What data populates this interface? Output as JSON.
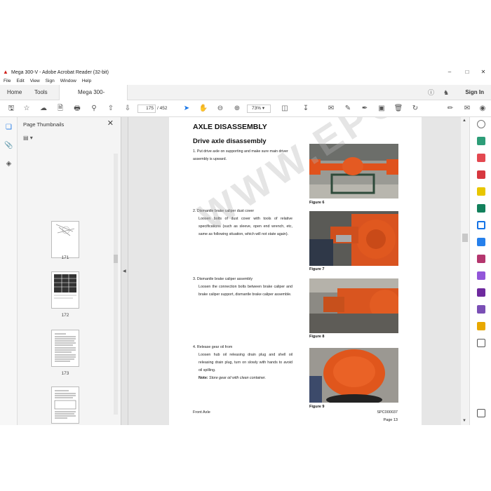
{
  "window": {
    "title": "Mega 300-V - Adobe Acrobat Reader (32-bit)",
    "minimize_icon": "minimize-icon",
    "maximize_icon": "maximize-icon",
    "close_icon": "close-icon"
  },
  "menu": [
    "File",
    "Edit",
    "View",
    "Sign",
    "Window",
    "Help"
  ],
  "tabs": {
    "home": "Home",
    "tools": "Tools",
    "document": "Mega 300-V",
    "sign_in": "Sign In"
  },
  "toolbar": {
    "current_page": "175",
    "total_pages": "/ 452",
    "zoom": "73%"
  },
  "thumbnails": {
    "title": "Page Thumbnails",
    "pages": [
      "171",
      "172",
      "173",
      "174",
      "175"
    ],
    "selected": "175"
  },
  "document": {
    "title": "AXLE DISASSEMBLY",
    "subtitle": "Drive axle disassembly",
    "steps": [
      {
        "heading": "1. Put drive axle on supporting and make sure main driver assembly is upward.",
        "body": "",
        "note": ""
      },
      {
        "heading": "2. Dismantle brake caliper dust cover",
        "body": "Loosen bolts of dust cover with tools of relative specifications (such as sleeve, open end wrench, etc, same as following situation, which will not state again).",
        "note": ""
      },
      {
        "heading": "3. Dismantle brake caliper assembly",
        "body": "Loosen the connection bolts between brake caliper and brake caliper support, dismantle brake caliper assemble.",
        "note": ""
      },
      {
        "heading": "4. Release gear oil from",
        "body": "Loosen hub oil releasing drain plug and shell oil releasing drain plug, turn on slowly with hands to avoid oil spilling.",
        "note_label": "Note:",
        "note": "Store gear oil with clean container."
      }
    ],
    "figures": [
      "Figure 6",
      "Figure 7",
      "Figure 8",
      "Figure 9"
    ],
    "footer_left": "Front Axle",
    "footer_code": "SPC000037",
    "footer_page": "Page 13",
    "watermark": "WWW.EPCLEAR.COM"
  },
  "colors": {
    "accent": "#1473e6",
    "brand_red": "#d0201a",
    "machine_orange": "#e0521c"
  }
}
